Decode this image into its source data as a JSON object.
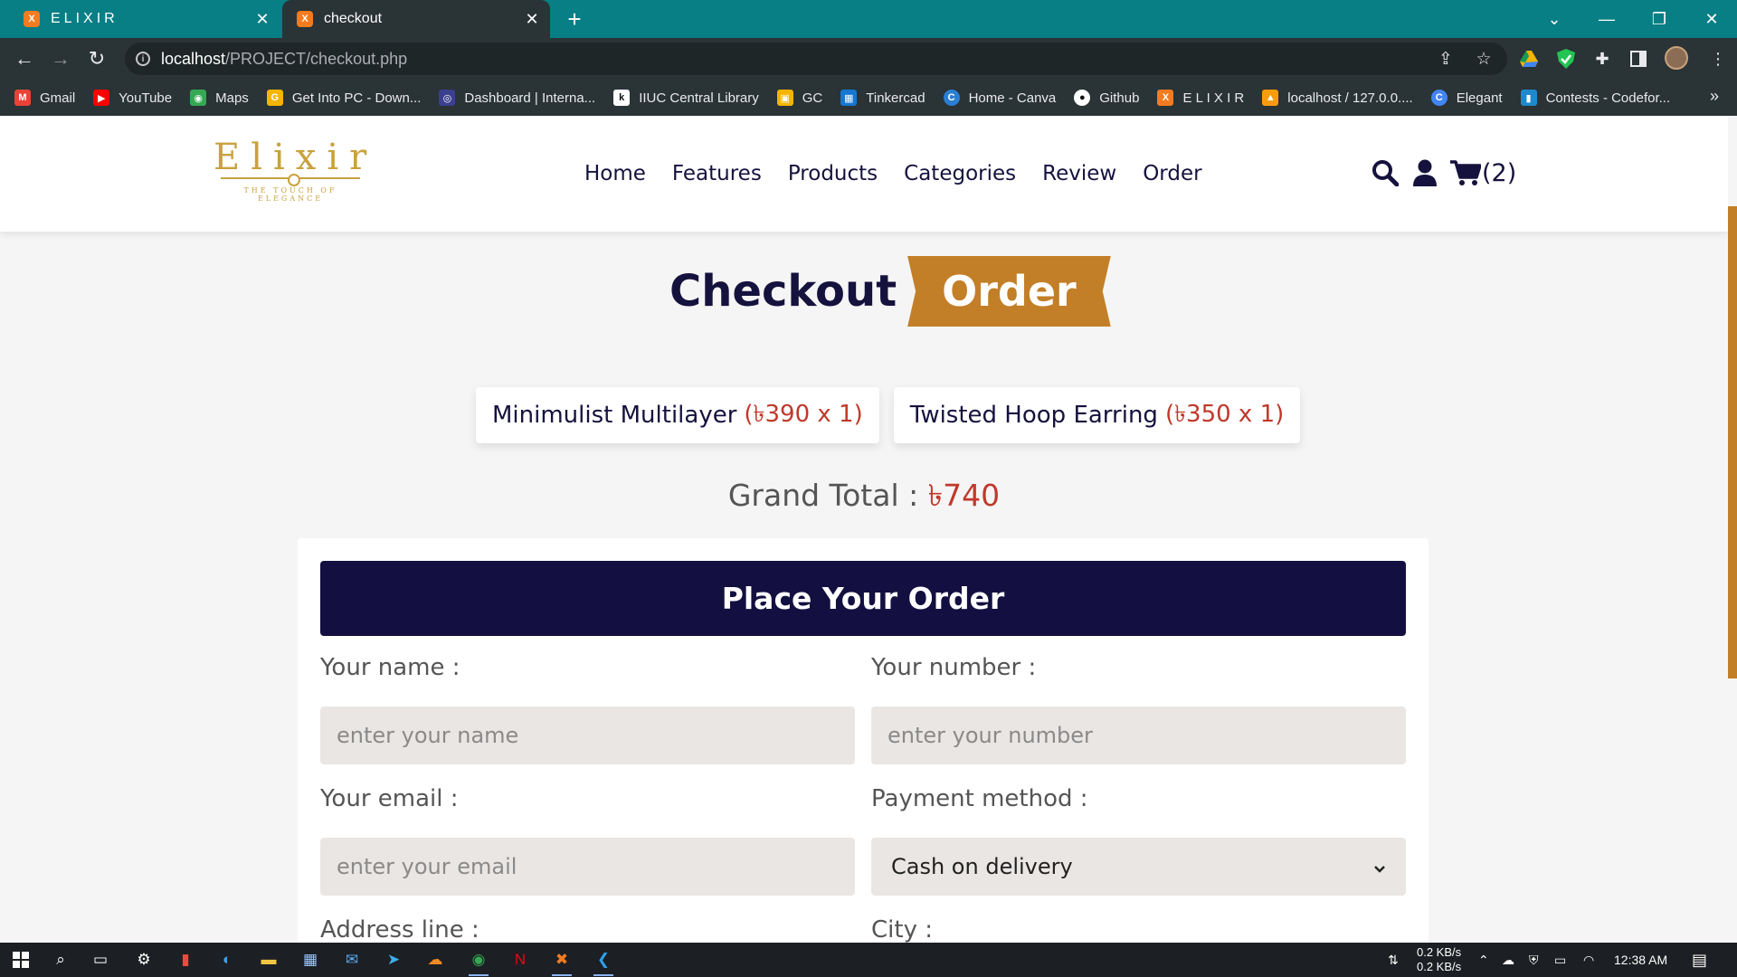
{
  "browser": {
    "tabs": [
      {
        "label": "ELIXIR",
        "active": false
      },
      {
        "label": "checkout",
        "active": true
      }
    ],
    "url_host": "localhost",
    "url_path": "/PROJECT/checkout.php",
    "bookmarks": [
      {
        "label": "Gmail",
        "icon": "gmail-icon",
        "color": "#ea4335"
      },
      {
        "label": "YouTube",
        "icon": "youtube-icon",
        "color": "#ff0000"
      },
      {
        "label": "Maps",
        "icon": "maps-icon",
        "color": "#34a853"
      },
      {
        "label": "Get Into PC - Down...",
        "icon": "getintopc-icon",
        "color": "#f4b400"
      },
      {
        "label": "Dashboard | Interna...",
        "icon": "dashboard-icon",
        "color": "#3b3f8f"
      },
      {
        "label": "IIUC Central Library",
        "icon": "library-icon",
        "color": "#333333"
      },
      {
        "label": "GC",
        "icon": "classroom-icon",
        "color": "#0f9d58"
      },
      {
        "label": "Tinkercad",
        "icon": "tinkercad-icon",
        "color": "#1477d1"
      },
      {
        "label": "Home - Canva",
        "icon": "canva-icon",
        "color": "#00c4cc"
      },
      {
        "label": "Github",
        "icon": "github-icon",
        "color": "#ffffff"
      },
      {
        "label": "E L I X I R",
        "icon": "xampp-icon",
        "color": "#f47b20"
      },
      {
        "label": "localhost / 127.0.0....",
        "icon": "phpmyadmin-icon",
        "color": "#f89c0e"
      },
      {
        "label": "Elegant",
        "icon": "elegant-icon",
        "color": "#4285f4"
      },
      {
        "label": "Contests - Codefor...",
        "icon": "codeforces-icon",
        "color": "#1f8acb"
      }
    ]
  },
  "site": {
    "logo": {
      "wordmark": "Elixir",
      "tagline": "THE TOUCH OF ELEGANCE"
    },
    "nav": [
      "Home",
      "Features",
      "Products",
      "Categories",
      "Review",
      "Order"
    ],
    "cart_count": "(2)"
  },
  "checkout": {
    "heading": "Checkout",
    "heading_ribbon": "Order",
    "items": [
      {
        "name": "Minimulist Multilayer",
        "price": "(৳390 x 1)"
      },
      {
        "name": "Twisted Hoop Earring",
        "price": "(৳350 x 1)"
      }
    ],
    "grand_total_label": "Grand Total :",
    "grand_total_value": "৳740"
  },
  "form": {
    "title": "Place Your Order",
    "name_label": "Your name :",
    "name_placeholder": "enter your name",
    "number_label": "Your number :",
    "number_placeholder": "enter your number",
    "email_label": "Your email :",
    "email_placeholder": "enter your email",
    "payment_label": "Payment method :",
    "payment_value": "Cash on delivery",
    "address_label": "Address line :",
    "city_label": "City :"
  },
  "taskbar": {
    "net_down": "0.2 KB/s",
    "net_up": "0.2 KB/s",
    "time": "12:38 AM"
  },
  "colors": {
    "accent": "#c37f27",
    "navy": "#130f40",
    "price_red": "#c0392b",
    "tabbar": "#087e85"
  }
}
